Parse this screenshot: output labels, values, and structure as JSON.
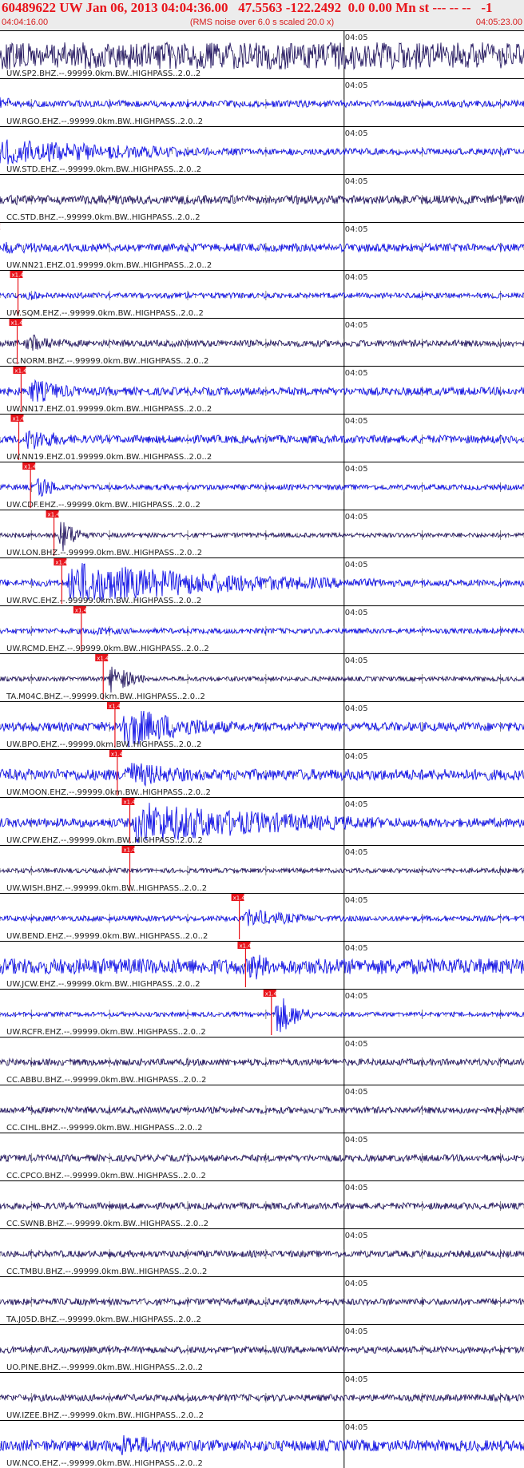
{
  "header": {
    "title": "60489622 UW Jan 06, 2013 04:04:36.00   47.5563 -122.2492  0.0 0.00 Mn st --- -- --   -1",
    "start_time": "04:04:16.00",
    "end_time": "04:05:23.00",
    "noise_note": "(RMS noise over 6.0 s scaled 20.0 x)"
  },
  "colors": {
    "header_text": "#e8141b",
    "trace_blue": "#1010e6",
    "trace_navy": "#231660",
    "pick": "#e8141b",
    "grid": "#000000"
  },
  "chart_data": {
    "type": "line",
    "title": "60489622 UW Jan 06, 2013 04:04:36.00   47.5563 -122.2492  0.0 0.00 Mn st --- -- --   -1",
    "x_range": [
      "04:04:16.00",
      "04:05:23.00"
    ],
    "minute_label": "04:05",
    "pick_label": "x1.4",
    "series": [
      {
        "name": "UW.SP2.BHZ.--.99999.0km.BW..HIGHPASS..2.0..2",
        "color": "navy",
        "amp": 0.6,
        "pick_s": 7.2,
        "burst_s": 8,
        "burst_amp": 0.75,
        "burst_len": 60
      },
      {
        "name": "UW.RGO.EHZ.--.99999.0km.BW..HIGHPASS..2.0..2",
        "color": "blue",
        "amp": 0.15,
        "pick_s": 11.0,
        "burst_s": 12,
        "burst_amp": 0.8,
        "burst_len": 7
      },
      {
        "name": "UW.STD.EHZ.--.99999.0km.BW..HIGHPASS..2.0..2",
        "color": "blue",
        "amp": 0.15,
        "pick_s": 11.8,
        "burst_s": 12.5,
        "burst_amp": 0.7,
        "burst_len": 40
      },
      {
        "name": "CC.STD.BHZ.--.99999.0km.BW..HIGHPASS..2.0..2",
        "color": "navy",
        "amp": 0.2,
        "pick_s": 12.4,
        "burst_s": 13,
        "burst_amp": 0.3,
        "burst_len": 30
      },
      {
        "name": "UW.NN21.EHZ.01.99999.0km.BW..HIGHPASS..2.0..2",
        "color": "blue",
        "amp": 0.18,
        "pick_s": 15.4,
        "burst_s": 16,
        "burst_amp": 0.3,
        "burst_len": 20
      },
      {
        "name": "UW.SQM.EHZ.--.99999.0km.BW..HIGHPASS..2.0..2",
        "color": "blue",
        "amp": 0.12,
        "pick_s": 18.3,
        "burst_s": 19,
        "burst_amp": 0.2,
        "burst_len": 10
      },
      {
        "name": "CC.NORM.BHZ.--.99999.0km.BW..HIGHPASS..2.0..2",
        "color": "navy",
        "amp": 0.15,
        "pick_s": 18.2,
        "burst_s": 19,
        "burst_amp": 0.5,
        "burst_len": 8
      },
      {
        "name": "UW.NN17.EHZ.01.99999.0km.BW..HIGHPASS..2.0..2",
        "color": "blue",
        "amp": 0.18,
        "pick_s": 18.7,
        "burst_s": 19.5,
        "burst_amp": 0.6,
        "burst_len": 10
      },
      {
        "name": "UW.NN19.EHZ.01.99999.0km.BW..HIGHPASS..2.0..2",
        "color": "blue",
        "amp": 0.18,
        "pick_s": 18.4,
        "burst_s": 19,
        "burst_amp": 0.55,
        "burst_len": 10
      },
      {
        "name": "UW.CDF.EHZ.--.99999.0km.BW..HIGHPASS..2.0..2",
        "color": "blue",
        "amp": 0.12,
        "pick_s": 19.9,
        "burst_s": 20.3,
        "burst_amp": 0.65,
        "burst_len": 4
      },
      {
        "name": "UW.LON.BHZ.--.99999.0km.BW..HIGHPASS..2.0..2",
        "color": "navy",
        "amp": 0.1,
        "pick_s": 22.9,
        "burst_s": 23.3,
        "burst_amp": 0.8,
        "burst_len": 4
      },
      {
        "name": "UW.RVC.EHZ.--.99999.0km.BW..HIGHPASS..2.0..2",
        "color": "blue",
        "amp": 0.15,
        "pick_s": 23.9,
        "burst_s": 24.5,
        "burst_amp": 1.0,
        "burst_len": 42
      },
      {
        "name": "UW.RCMD.EHZ.--.99999.0km.BW..HIGHPASS..2.0..2",
        "color": "blue",
        "amp": 0.12,
        "pick_s": 26.4,
        "burst_s": 27,
        "burst_amp": 0.2,
        "burst_len": 20
      },
      {
        "name": "TA.M04C.BHZ.--.99999.0km.BW..HIGHPASS..2.0..2",
        "color": "navy",
        "amp": 0.1,
        "pick_s": 29.2,
        "burst_s": 29.7,
        "burst_amp": 0.75,
        "burst_len": 5
      },
      {
        "name": "UW.BPO.EHZ.--.99999.0km.BW..HIGHPASS..2.0..2",
        "color": "blue",
        "amp": 0.2,
        "pick_s": 30.7,
        "burst_s": 31,
        "burst_amp": 1.0,
        "burst_len": 18
      },
      {
        "name": "UW.MOON.EHZ.--.99999.0km.BW..HIGHPASS..2.0..2",
        "color": "blue",
        "amp": 0.25,
        "pick_s": 31.0,
        "burst_s": 31.5,
        "burst_amp": 0.65,
        "burst_len": 17
      },
      {
        "name": "UW.CPW.EHZ.--.99999.0km.BW..HIGHPASS..2.0..2",
        "color": "blue",
        "amp": 0.2,
        "pick_s": 32.6,
        "burst_s": 32.9,
        "burst_amp": 1.0,
        "burst_len": 40
      },
      {
        "name": "UW.WISH.BHZ.--.99999.0km.BW..HIGHPASS..2.0..2",
        "color": "navy",
        "amp": 0.1,
        "pick_s": 32.6,
        "burst_s": 33,
        "burst_amp": 0.1,
        "burst_len": 5
      },
      {
        "name": "UW.BEND.EHZ.--.99999.0km.BW..HIGHPASS..2.0..2",
        "color": "blue",
        "amp": 0.12,
        "pick_s": 46.6,
        "burst_s": 47,
        "burst_amp": 0.45,
        "burst_len": 14
      },
      {
        "name": "UW.JCW.EHZ.--.99999.0km.BW..HIGHPASS..2.0..2",
        "color": "blue",
        "amp": 0.35,
        "pick_s": 47.4,
        "burst_s": 47.6,
        "burst_amp": 0.8,
        "burst_len": 5
      },
      {
        "name": "UW.RCFR.EHZ.--.99999.0km.BW..HIGHPASS..2.0..2",
        "color": "blue",
        "amp": 0.1,
        "pick_s": 50.7,
        "burst_s": 50.9,
        "burst_amp": 1.0,
        "burst_len": 5
      },
      {
        "name": "CC.ABBU.BHZ.--.99999.0km.BW..HIGHPASS..2.0..2",
        "color": "navy",
        "amp": 0.15,
        "pick_s": null,
        "burst_s": null,
        "burst_amp": 0,
        "burst_len": 0
      },
      {
        "name": "CC.CIHL.BHZ.--.99999.0km.BW..HIGHPASS..2.0..2",
        "color": "navy",
        "amp": 0.15,
        "pick_s": null,
        "burst_s": null,
        "burst_amp": 0,
        "burst_len": 0
      },
      {
        "name": "CC.CPCO.BHZ.--.99999.0km.BW..HIGHPASS..2.0..2",
        "color": "navy",
        "amp": 0.15,
        "pick_s": null,
        "burst_s": null,
        "burst_amp": 0,
        "burst_len": 0
      },
      {
        "name": "CC.SWNB.BHZ.--.99999.0km.BW..HIGHPASS..2.0..2",
        "color": "navy",
        "amp": 0.15,
        "pick_s": null,
        "burst_s": null,
        "burst_amp": 0,
        "burst_len": 0
      },
      {
        "name": "CC.TMBU.BHZ.--.99999.0km.BW..HIGHPASS..2.0..2",
        "color": "navy",
        "amp": 0.15,
        "pick_s": null,
        "burst_s": null,
        "burst_amp": 0,
        "burst_len": 0
      },
      {
        "name": "TA.J05D.BHZ.--.99999.0km.BW..HIGHPASS..2.0..2",
        "color": "navy",
        "amp": 0.15,
        "pick_s": null,
        "burst_s": null,
        "burst_amp": 0,
        "burst_len": 0
      },
      {
        "name": "UO.PINE.BHZ.--.99999.0km.BW..HIGHPASS..2.0..2",
        "color": "navy",
        "amp": 0.15,
        "pick_s": null,
        "burst_s": null,
        "burst_amp": 0,
        "burst_len": 0
      },
      {
        "name": "UW.IZEE.BHZ.--.99999.0km.BW..HIGHPASS..2.0..2",
        "color": "navy",
        "amp": 0.15,
        "pick_s": null,
        "burst_s": null,
        "burst_amp": 0,
        "burst_len": 0
      },
      {
        "name": "UW.NCO.EHZ.--.99999.0km.BW..HIGHPASS..2.0..2",
        "color": "blue",
        "amp": 0.25,
        "pick_s": null,
        "burst_s": 31,
        "burst_amp": 0.55,
        "burst_len": 18
      }
    ]
  }
}
